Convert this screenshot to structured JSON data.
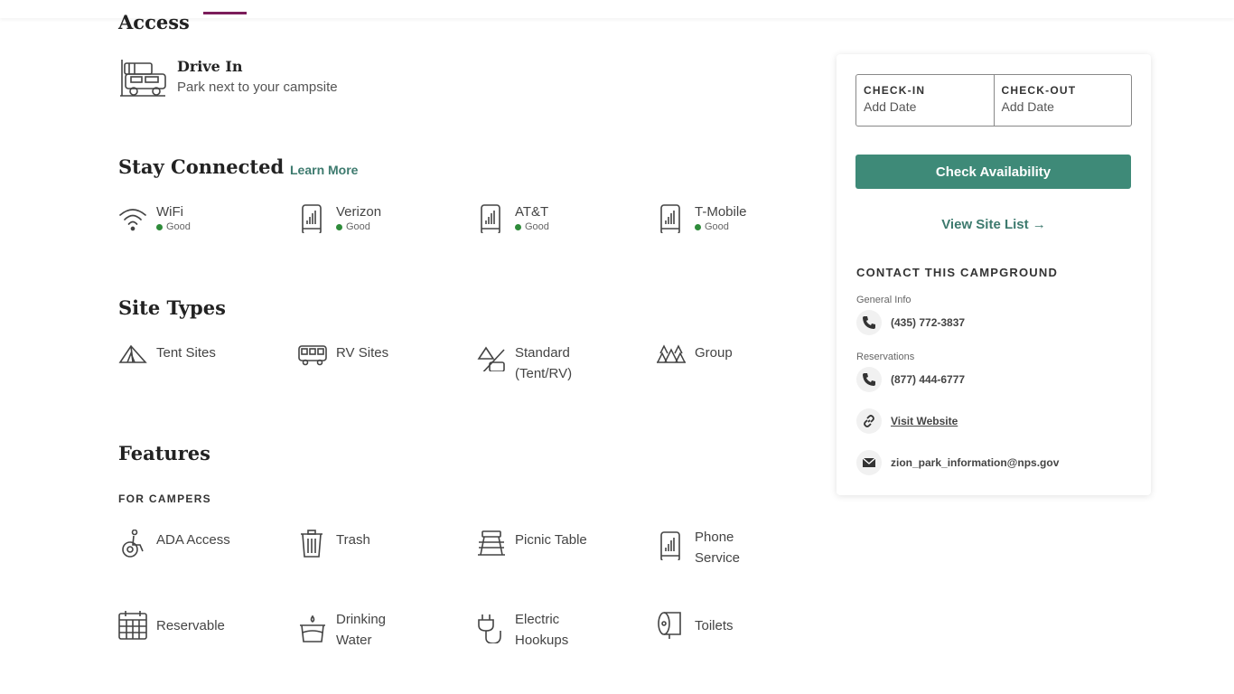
{
  "access": {
    "title": "Access",
    "item_title": "Drive In",
    "item_sub": "Park next to your campsite",
    "icon": "car-icon"
  },
  "connected": {
    "title": "Stay Connected",
    "learn_more": "Learn More",
    "items": [
      {
        "name": "WiFi",
        "status": "Good",
        "icon": "wifi-icon"
      },
      {
        "name": "Verizon",
        "status": "Good",
        "icon": "phone-signal-icon"
      },
      {
        "name": "AT&T",
        "status": "Good",
        "icon": "phone-signal-icon"
      },
      {
        "name": "T-Mobile",
        "status": "Good",
        "icon": "phone-signal-icon"
      }
    ],
    "status_color": "#2e8b3a"
  },
  "site_types": {
    "title": "Site Types",
    "items": [
      {
        "label": "Tent Sites",
        "icon": "tent-icon"
      },
      {
        "label": "RV Sites",
        "icon": "rv-icon"
      },
      {
        "label": "Standard (Tent/RV)",
        "icon": "tent-rv-icon"
      },
      {
        "label": "Group",
        "icon": "group-tents-icon"
      }
    ]
  },
  "features": {
    "title": "Features",
    "sub": "FOR CAMPERS",
    "items": [
      {
        "label": "ADA Access",
        "icon": "wheelchair-icon"
      },
      {
        "label": "Trash",
        "icon": "trash-icon"
      },
      {
        "label": "Picnic Table",
        "icon": "picnic-table-icon"
      },
      {
        "label": "Phone Service",
        "icon": "phone-signal-icon"
      },
      {
        "label": "Reservable",
        "icon": "calendar-icon"
      },
      {
        "label": "Drinking Water",
        "icon": "water-icon"
      },
      {
        "label": "Electric Hookups",
        "icon": "plug-icon"
      },
      {
        "label": "Toilets",
        "icon": "toilet-paper-icon"
      }
    ]
  },
  "booking": {
    "check_in_label": "CHECK-IN",
    "check_in_value": "Add Date",
    "check_out_label": "CHECK-OUT",
    "check_out_value": "Add Date",
    "cta": "Check Availability",
    "view_list": "View Site List →",
    "accent": "#3e8a78"
  },
  "contact": {
    "title": "CONTACT THIS CAMPGROUND",
    "general_label": "General Info",
    "general_phone": "(435) 772-3837",
    "reservations_label": "Reservations",
    "reservations_phone": "(877) 444-6777",
    "website": "Visit Website",
    "email": "zion_park_information@nps.gov"
  }
}
